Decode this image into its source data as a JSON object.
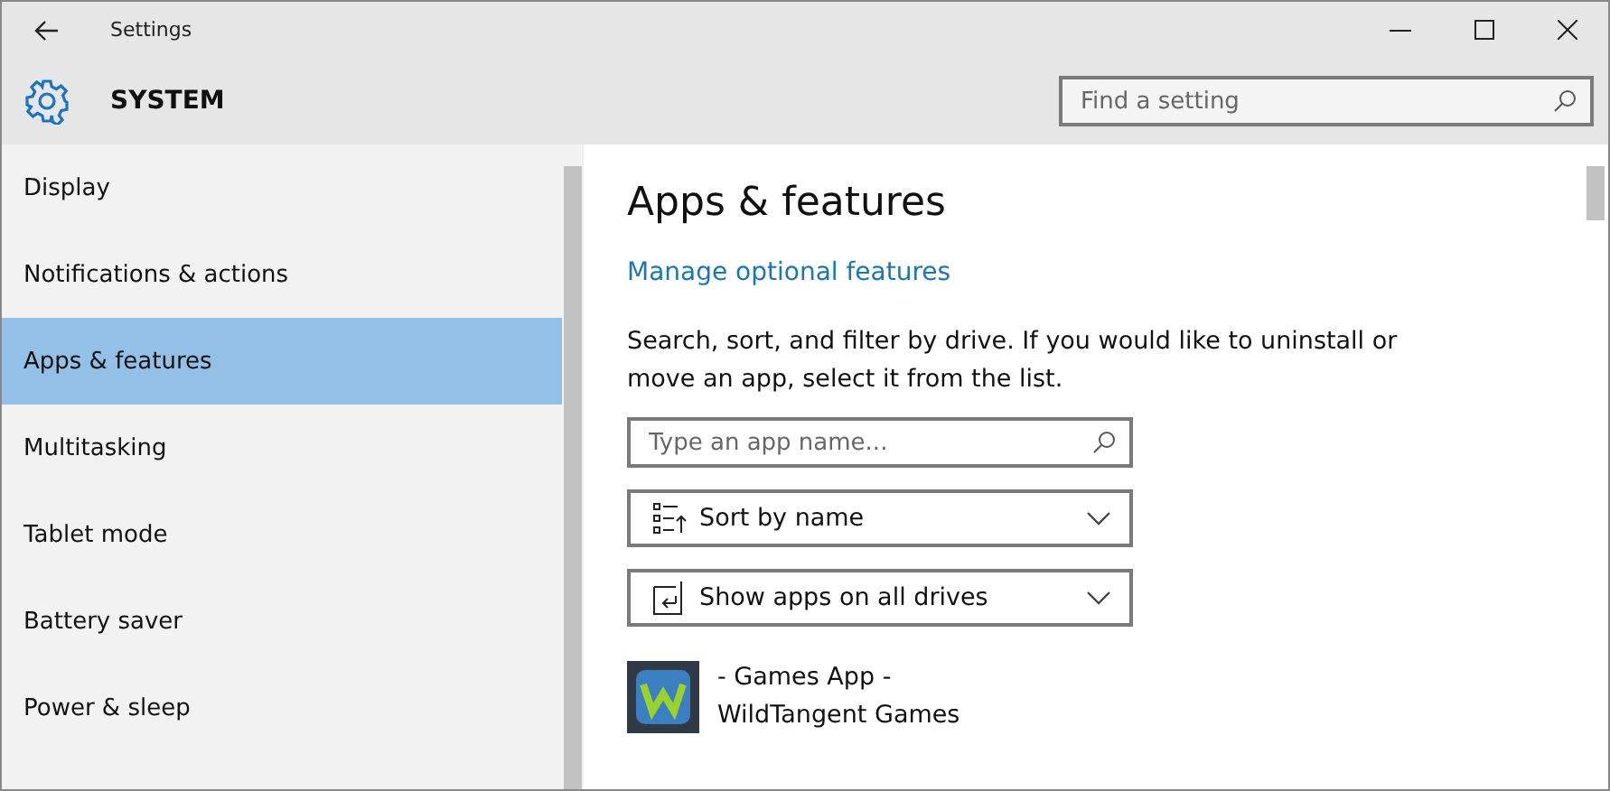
{
  "window": {
    "title": "Settings"
  },
  "header": {
    "title": "SYSTEM",
    "search": {
      "placeholder": "Find a setting"
    }
  },
  "sidebar": {
    "items": [
      {
        "label": "Display",
        "selected": false
      },
      {
        "label": "Notifications & actions",
        "selected": false
      },
      {
        "label": "Apps & features",
        "selected": true
      },
      {
        "label": "Multitasking",
        "selected": false
      },
      {
        "label": "Tablet mode",
        "selected": false
      },
      {
        "label": "Battery saver",
        "selected": false
      },
      {
        "label": "Power & sleep",
        "selected": false
      }
    ]
  },
  "content": {
    "title": "Apps & features",
    "link": "Manage optional features",
    "description": "Search, sort, and filter by drive. If you would like to uninstall or move an app, select it from the list.",
    "search": {
      "placeholder": "Type an app name..."
    },
    "dropdowns": [
      {
        "kind": "sort",
        "label": "Sort by name"
      },
      {
        "kind": "drive",
        "label": "Show apps on all drives"
      }
    ],
    "apps": [
      {
        "name": "- Games App -",
        "publisher": "WildTangent Games"
      }
    ]
  }
}
